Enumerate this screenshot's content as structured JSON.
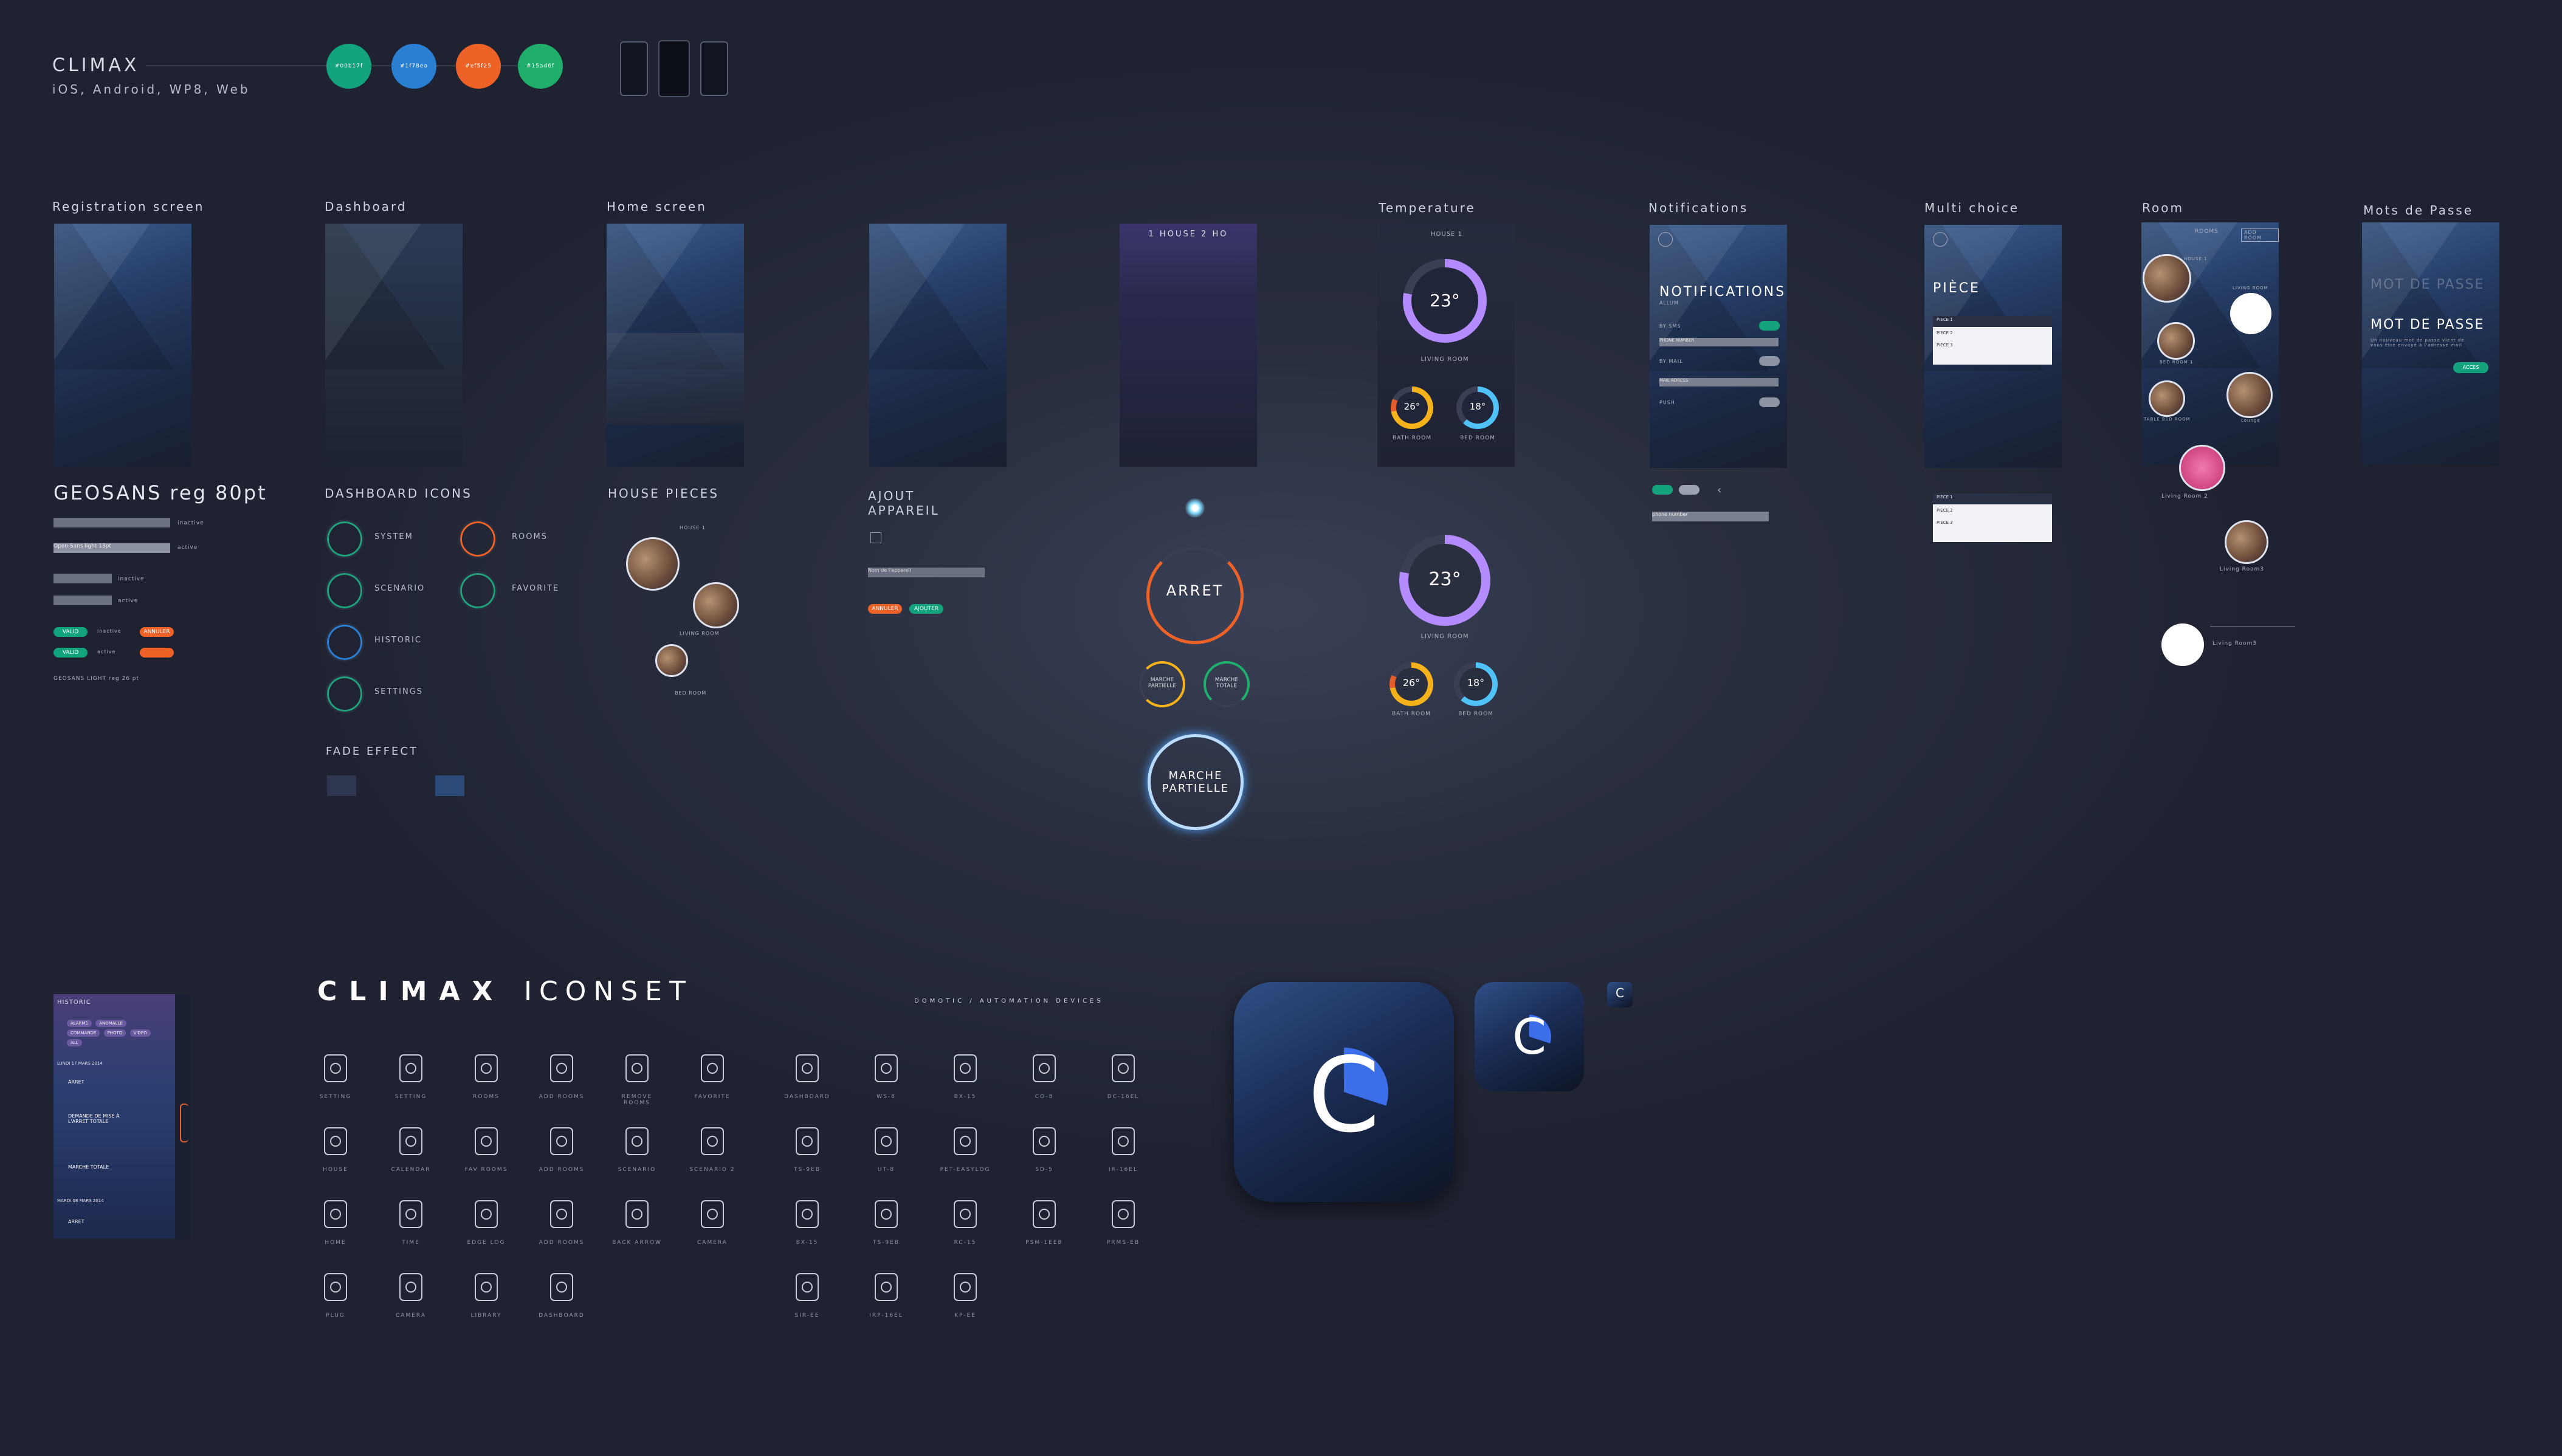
{
  "header": {
    "title": "CLIMAX",
    "subtitle": "iOS, Android, WP8, Web",
    "swatches": [
      {
        "label": "#00b17f",
        "color": "#13a47d"
      },
      {
        "label": "#1f78ea",
        "color": "#2b7fd3"
      },
      {
        "label": "#ef5f25",
        "color": "#ee6227"
      },
      {
        "label": "#15ad6f",
        "color": "#1fae6c"
      }
    ]
  },
  "sections": {
    "registration": "Registration screen",
    "dashboard": "Dashboard",
    "home": "Home screen",
    "temperature": "Temperature",
    "notifications": "Notifications",
    "multichoice": "Multi choice",
    "room": "Room",
    "password": "Mots de Passe"
  },
  "typo": {
    "heading": "GEOSANS reg 80pt",
    "field_placeholder": "Open Sans light 13pt",
    "inactive": "inactive",
    "active": "active",
    "valid": "VALID",
    "annuler": "ANNULER",
    "light_note": "GEOSANS LIGHT reg 26 pt"
  },
  "dashboard_icons": {
    "title": "DASHBOARD  ICONS",
    "items": [
      "SYSTEM",
      "ROOMS",
      "SCENARIO",
      "FAVORITE",
      "HISTORIC",
      "SETTINGS"
    ],
    "fade": "FADE EFFECT"
  },
  "house_pieces": {
    "title": "HOUSE PIECES",
    "labels": [
      "HOUSE 1",
      "LIVING ROOM",
      "BED ROOM"
    ]
  },
  "ajout": {
    "title": "AJOUT\nAPPAREIL",
    "field": "Nom de l'appareil",
    "annuler": "ANNULER",
    "ajouter": "AJOUTER"
  },
  "tabs_phone": {
    "title": "1  HOUSE 2  HO"
  },
  "modes": {
    "arret": "ARRET",
    "marche_partielle": "MARCHE\nPARTIELLE",
    "marche_totale": "MARCHE\nTOTALE",
    "big_partielle": "MARCHE\nPARTIELLE"
  },
  "temperature": {
    "house": "HOUSE 1",
    "main": "23°",
    "main_label": "LIVING ROOM",
    "bath": "26°",
    "bath_label": "BATH ROOM",
    "bed": "18°",
    "bed_label": "BED ROOM"
  },
  "notifications": {
    "title": "NOTIFICATIONS",
    "sub": "ALLUM",
    "rows": [
      "BY SMS",
      "PHONE NUMBER",
      "BY MAIL",
      "MAIL ADRESS",
      "PUSH"
    ],
    "field": "phone number"
  },
  "multichoice": {
    "title": "PIÈCE",
    "items": [
      "PIECE 1",
      "PIECE 2",
      "PIECE 3"
    ]
  },
  "room": {
    "top": "ROOMS",
    "btn": "ADD ROOM",
    "labels": [
      "HOUSE 1",
      "LIVING ROOM",
      "BED ROOM 1",
      "Lounge",
      "TABLE BED ROOM",
      "Living Room 2",
      "Living Room3"
    ]
  },
  "password": {
    "title": "MOT DE PASSE",
    "text": "Un nouveau mot de passe vient de vous être envoyé à l'adresse mail",
    "btn": "ACCES"
  },
  "historic": {
    "title": "HISTORIC",
    "chips": [
      "ALARMS",
      "ANOMALLE",
      "COMMANDE",
      "PHOTO",
      "VIDEO",
      "ALL"
    ],
    "day1": "LUNDI 17 MARS 2014",
    "e1": "ARRET",
    "e2": "DEMANDE DE MISE À L'ARRET TOTALE",
    "e3": "MARCHE TOTALE",
    "day2": "MARDI 08 MARS 2014",
    "e4": "ARRET"
  },
  "iconset": {
    "brand": "CLIMAX",
    "set": "ICONSET",
    "domotic": "DOMOTIC / AUTOMATION DEVICES",
    "left": [
      [
        "SETTING",
        "SETTING",
        "ROOMS",
        "ADD ROOMS",
        "REMOVE ROOMS",
        "FAVORITE"
      ],
      [
        "HOUSE",
        "CALENDAR",
        "FAV ROOMS",
        "ADD ROOMS",
        "SCENARIO",
        "SCENARIO 2"
      ],
      [
        "HOME",
        "TIME",
        "EDGE LOG",
        "ADD ROOMS",
        "BACK ARROW",
        "CAMERA"
      ],
      [
        "PLUG",
        "CAMERA",
        "LIBRARY",
        "DASHBOARD"
      ]
    ],
    "right": [
      [
        "DASHBOARD",
        "WS-8",
        "BX-15",
        "CO-8",
        "DC-16EL"
      ],
      [
        "TS-9EB",
        "UT-8",
        "PET-EASYLOG",
        "SD-5",
        "IR-16EL"
      ],
      [
        "BX-15",
        "TS-9EB",
        "RC-15",
        "PSM-1EEB",
        "PRMS-EB"
      ],
      [
        "SIR-EE",
        "IRP-16EL",
        "KP-EE"
      ]
    ]
  },
  "appicon": {
    "letter": "C"
  }
}
